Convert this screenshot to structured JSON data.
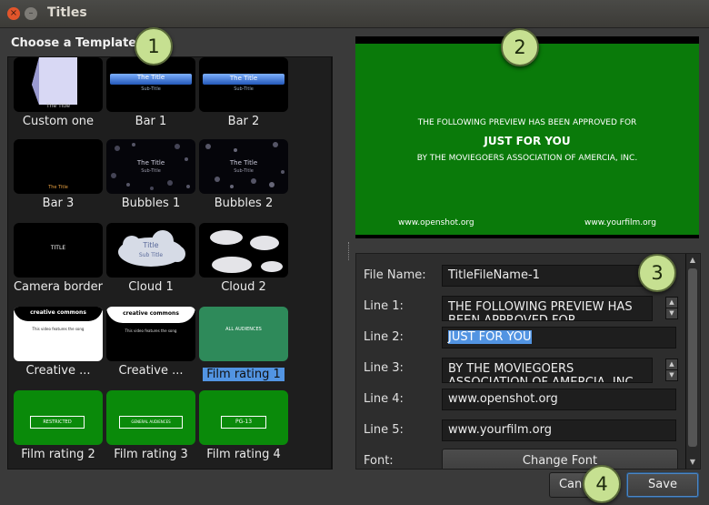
{
  "window": {
    "title": "Titles",
    "close_glyph": "×",
    "minimize_glyph": "–"
  },
  "badges": [
    "1",
    "2",
    "3",
    "4"
  ],
  "templates_section": {
    "title": "Choose a Template"
  },
  "templates": [
    {
      "label": "Custom one",
      "thumb_text": "The Title",
      "thumb_sub": ""
    },
    {
      "label": "Bar 1",
      "thumb_text": "The Title",
      "thumb_sub": "Sub-Title"
    },
    {
      "label": "Bar 2",
      "thumb_text": "The Title",
      "thumb_sub": "Sub-Title"
    },
    {
      "label": "Bar 3",
      "thumb_text": "The Title",
      "thumb_sub": ""
    },
    {
      "label": "Bubbles 1",
      "thumb_text": "The Title",
      "thumb_sub": "Sub-Title"
    },
    {
      "label": "Bubbles 2",
      "thumb_text": "The Title",
      "thumb_sub": "Sub-Title"
    },
    {
      "label": "Camera border",
      "thumb_text": "TITLE",
      "thumb_sub": ""
    },
    {
      "label": "Cloud 1",
      "thumb_text": "Title",
      "thumb_sub": "Sub Title"
    },
    {
      "label": "Cloud 2",
      "thumb_text": "",
      "thumb_sub": ""
    },
    {
      "label": "Creative ...",
      "thumb_text": "creative commons",
      "thumb_sub": "This video features the song"
    },
    {
      "label": "Creative ...",
      "thumb_text": "creative commons",
      "thumb_sub": "This video features the song"
    },
    {
      "label": "Film rating 1",
      "thumb_text": "ALL AUDIENCES",
      "thumb_sub": ""
    },
    {
      "label": "Film rating 2",
      "thumb_text": "RESTRICTED",
      "thumb_sub": ""
    },
    {
      "label": "Film rating 3",
      "thumb_text": "GENERAL AUDIENCES",
      "thumb_sub": ""
    },
    {
      "label": "Film rating 4",
      "thumb_text": "PG-13",
      "thumb_sub": ""
    }
  ],
  "selected_template_index": 11,
  "preview": {
    "line1": "THE FOLLOWING PREVIEW HAS BEEN APPROVED FOR",
    "line2": "JUST FOR YOU",
    "line3": "BY THE MOVIEGOERS ASSOCIATION OF AMERCIA, INC.",
    "line4": "www.openshot.org",
    "line5": "www.yourfilm.org",
    "background_color": "#0a7a0a"
  },
  "form": {
    "file_name_label": "File Name:",
    "file_name_value": "TitleFileName-1",
    "line1_label": "Line 1:",
    "line1_value": "THE FOLLOWING PREVIEW HAS BEEN APPROVED FOR",
    "line2_label": "Line 2:",
    "line2_value": "JUST FOR YOU",
    "line3_label": "Line 3:",
    "line3_value": "BY THE MOVIEGOERS ASSOCIATION OF AMERCIA, INC.",
    "line4_label": "Line 4:",
    "line4_value": "www.openshot.org",
    "line5_label": "Line 5:",
    "line5_value": "www.yourfilm.org",
    "font_label": "Font:",
    "font_button": "Change Font"
  },
  "buttons": {
    "cancel": "Cancel",
    "save": "Save"
  }
}
